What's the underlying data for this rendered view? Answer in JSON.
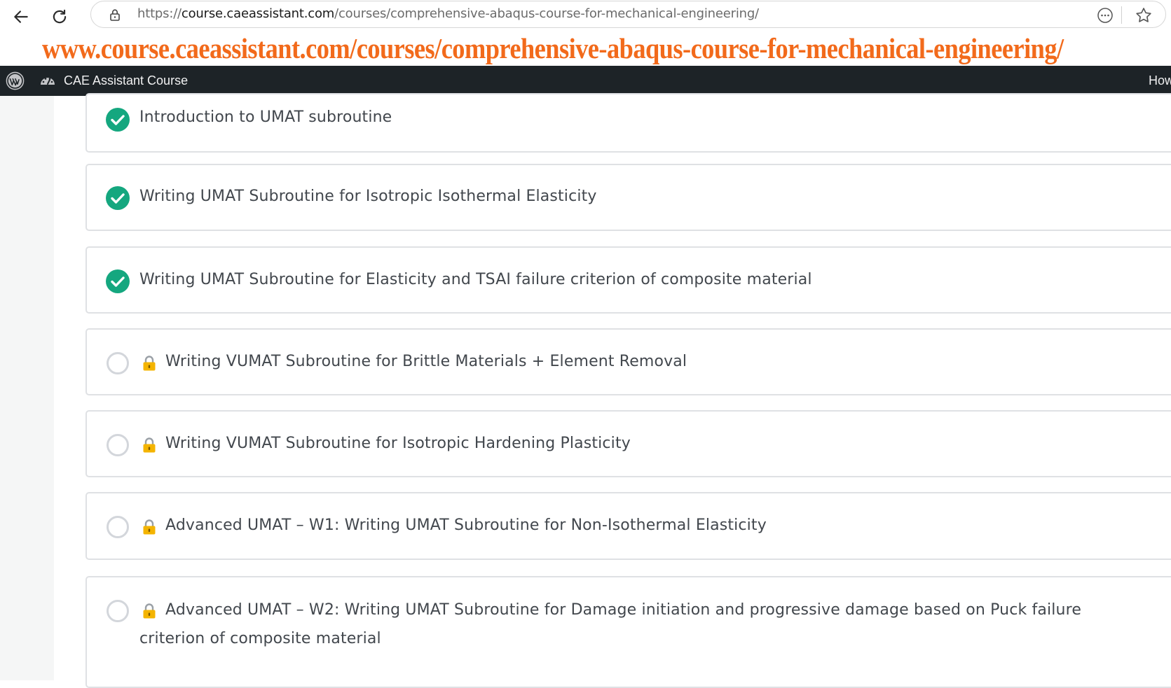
{
  "browser": {
    "url_protocol": "https://",
    "url_host": "course.caeassistant.com",
    "url_path": "/courses/comprehensive-abaqus-course-for-mechanical-engineering/",
    "icons": [
      "back-arrow-icon",
      "reload-icon",
      "lock-icon",
      "more-options-icon",
      "favorite-star-icon"
    ]
  },
  "banner": {
    "text": "www.course.caeassistant.com/courses/comprehensive-abaqus-course-for-mechanical-engineering/",
    "color": "#f26a1b"
  },
  "admin_bar": {
    "site_name": "CAE Assistant Course",
    "right_text": "How",
    "background": "#1d2327",
    "icons": [
      "wordpress-logo-icon",
      "dashboard-icon"
    ]
  },
  "lessons": [
    {
      "title": "Introduction to UMAT subroutine",
      "status": "completed",
      "locked": false
    },
    {
      "title": "Writing UMAT Subroutine for Isotropic Isothermal Elasticity",
      "status": "completed",
      "locked": false
    },
    {
      "title": "Writing UMAT Subroutine for Elasticity and TSAI failure criterion of composite material",
      "status": "completed",
      "locked": false
    },
    {
      "title": "Writing VUMAT Subroutine for Brittle Materials + Element Removal",
      "status": "incomplete",
      "locked": true
    },
    {
      "title": "Writing VUMAT Subroutine for Isotropic Hardening Plasticity",
      "status": "incomplete",
      "locked": true
    },
    {
      "title": "Advanced UMAT – W1: Writing UMAT Subroutine for Non-Isothermal Elasticity",
      "status": "incomplete",
      "locked": true
    },
    {
      "title": "Advanced UMAT – W2: Writing UMAT Subroutine for Damage initiation and progressive damage based on Puck failure criterion of composite material",
      "status": "incomplete",
      "locked": true
    }
  ],
  "colors": {
    "completed_green": "#15a77f",
    "incomplete_ring": "#d3d6db",
    "lock_gold": "#f4b400",
    "card_border": "#dfe1e4",
    "text": "#42474d"
  }
}
